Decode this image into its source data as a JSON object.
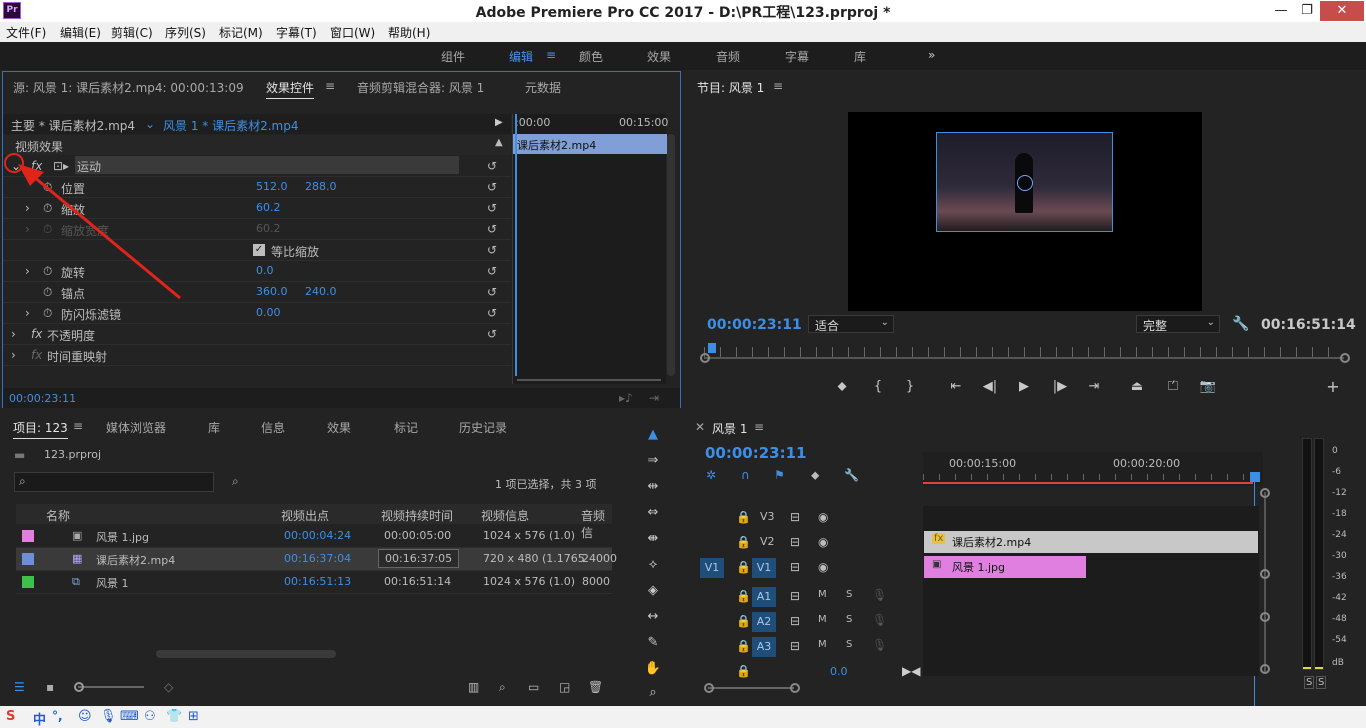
{
  "window": {
    "title": "Adobe Premiere Pro CC 2017 - D:\\PR工程\\123.prproj *",
    "logo": "Pr",
    "minimize": "—",
    "restore": "❐",
    "close": "✕"
  },
  "menu": [
    "文件(F)",
    "编辑(E)",
    "剪辑(C)",
    "序列(S)",
    "标记(M)",
    "字幕(T)",
    "窗口(W)",
    "帮助(H)"
  ],
  "workspaces": {
    "items": [
      "组件",
      "编辑",
      "颜色",
      "效果",
      "音频",
      "字幕",
      "库"
    ],
    "active": "编辑",
    "more": "»",
    "menu": "≡"
  },
  "effect_controls": {
    "tabs": {
      "source": "源: 风景 1: 课后素材2.mp4: 00:00:13:09",
      "effect_controls": "效果控件",
      "audio_mixer": "音频剪辑混合器: 风景 1",
      "metadata": "元数据"
    },
    "master_label": "主要 * 课后素材2.mp4",
    "sequence_label": "风景 1 * 课后素材2.mp4",
    "section_video": "视频效果",
    "motion": "运动",
    "position_label": "位置",
    "position_x": "512.0",
    "position_y": "288.0",
    "scale_label": "缩放",
    "scale_value": "60.2",
    "scale_width_label": "缩放宽度",
    "scale_width_value": "60.2",
    "uniform_scale": "等比缩放",
    "rotation_label": "旋转",
    "rotation_value": "0.0",
    "anchor_label": "锚点",
    "anchor_x": "360.0",
    "anchor_y": "240.0",
    "flicker_label": "防闪烁滤镜",
    "flicker_value": "0.00",
    "opacity_label": "不透明度",
    "time_remap_label": "时间重映射",
    "mini_tl_start": ":00:00",
    "mini_tl_mid": "00:15:00",
    "mini_clip": "课后素材2.mp4",
    "timecode": "00:00:23:11"
  },
  "program": {
    "title": "节目: 风景 1",
    "timecode": "00:00:23:11",
    "fit": "适合",
    "quality": "完整",
    "duration": "00:16:51:14"
  },
  "project": {
    "tabs": [
      "项目: 123",
      "媒体浏览器",
      "库",
      "信息",
      "效果",
      "标记",
      "历史记录"
    ],
    "file": "123.prproj",
    "selection": "1 项已选择，共 3 项",
    "headers": [
      "名称",
      "视频出点",
      "视频持续时间",
      "视频信息",
      "音频信"
    ],
    "rows": [
      {
        "name": "风景 1.jpg",
        "out": "00:00:04:24",
        "dur": "00:00:05:00",
        "info": "1024 x 576 (1.0)",
        "audio": "",
        "color": "#e07fe0"
      },
      {
        "name": "课后素材2.mp4",
        "out": "00:16:37:04",
        "dur": "00:16:37:05",
        "info": "720 x 480 (1.1765",
        "audio": "24000",
        "color": "#6c8fd6"
      },
      {
        "name": "风景 1",
        "out": "00:16:51:13",
        "dur": "00:16:51:14",
        "info": "1024 x 576 (1.0)",
        "audio": "8000",
        "color": "#3fc04a"
      }
    ]
  },
  "timeline": {
    "title": "风景 1",
    "timecode": "00:00:23:11",
    "ruler": [
      "00:00:15:00",
      "00:00:20:00"
    ],
    "video_tracks": [
      "V3",
      "V2",
      "V1"
    ],
    "audio_tracks": [
      "A1",
      "A2",
      "A3"
    ],
    "source_v": "V1",
    "mix_value": "0.0",
    "clip_v2": "课后素材2.mp4",
    "clip_v1": "风景 1.jpg",
    "m": "M",
    "s": "S"
  },
  "meter": {
    "labels": [
      "0",
      "-6",
      "-12",
      "-18",
      "-24",
      "-30",
      "-36",
      "-42",
      "-48",
      "-54",
      "dB"
    ],
    "s1": "S",
    "s2": "S"
  },
  "taskbar": {
    "ime": "中",
    "punct": "°,"
  },
  "colors": {
    "accent": "#3d8fe6",
    "playhead_range": "#e04040",
    "clip_v2": "#c8c8c8",
    "clip_v1": "#e07fe0",
    "annotation_arrow": "#e0241b"
  }
}
